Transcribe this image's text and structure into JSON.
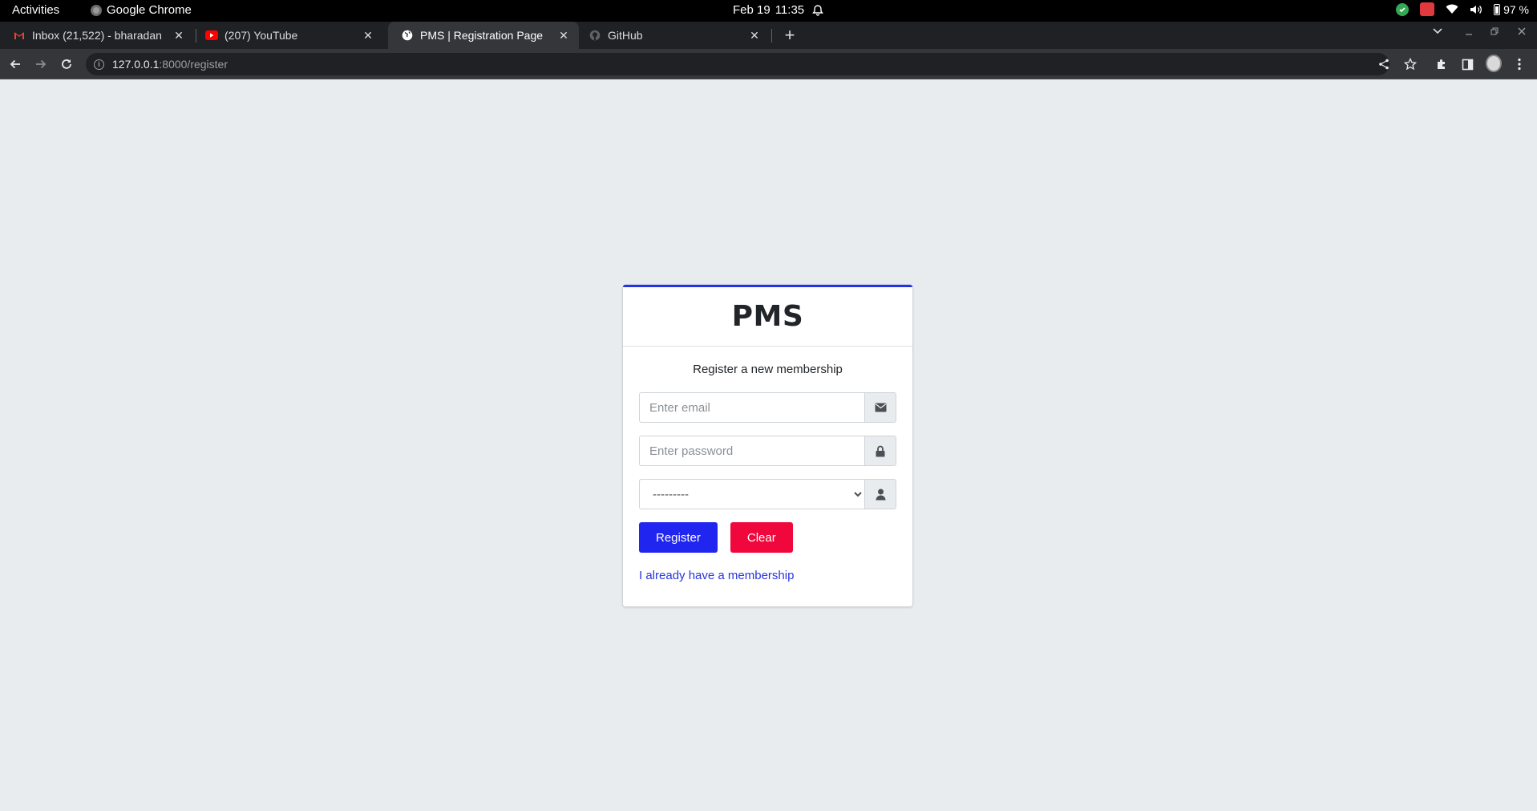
{
  "system_bar": {
    "activities": "Activities",
    "app_name": "Google Chrome",
    "date": "Feb 19",
    "time": "11:35",
    "battery": "97 %"
  },
  "browser": {
    "tabs": [
      {
        "title": "Inbox (21,522) - bharadan",
        "favicon": "gmail-icon",
        "active": false
      },
      {
        "title": "(207) YouTube",
        "favicon": "youtube-icon",
        "active": false
      },
      {
        "title": "PMS | Registration Page",
        "favicon": "globe-icon",
        "active": true
      },
      {
        "title": "GitHub",
        "favicon": "github-icon",
        "active": false
      }
    ],
    "address": {
      "host": "127.0.0.1",
      "path": ":8000/register"
    }
  },
  "page": {
    "brand": "PMS",
    "message": "Register a new membership",
    "email_placeholder": "Enter email",
    "password_placeholder": "Enter password",
    "role_selected": "---------",
    "register_label": "Register",
    "clear_label": "Clear",
    "login_link": "I already have a membership"
  },
  "colors": {
    "accent": "#2233e8",
    "primary_button": "#2026f0",
    "danger_button": "#f0073b",
    "page_background": "#e9ecef"
  }
}
